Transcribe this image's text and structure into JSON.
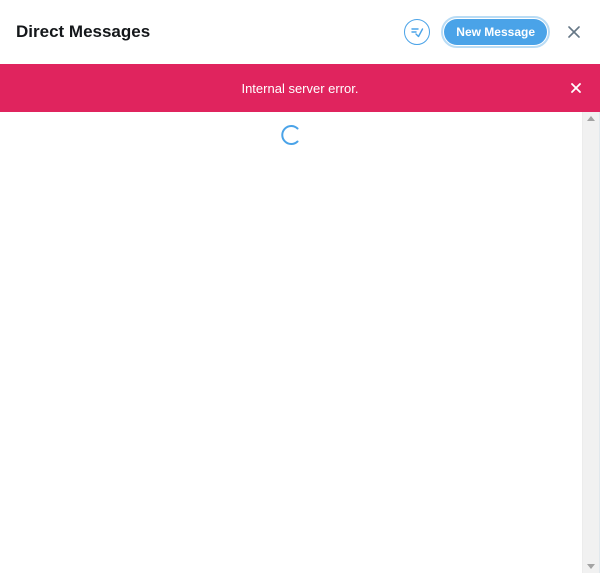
{
  "header": {
    "title": "Direct Messages",
    "mark_read_icon": "check-circle-icon",
    "new_message_label": "New Message",
    "close_icon": "close-icon"
  },
  "banner": {
    "message": "Internal server error.",
    "close_icon": "close-icon",
    "color": "#e0245e"
  },
  "content": {
    "loading_icon": "spinner-icon"
  },
  "colors": {
    "accent": "#4aa3e8",
    "error": "#e0245e",
    "title": "#14171a"
  }
}
